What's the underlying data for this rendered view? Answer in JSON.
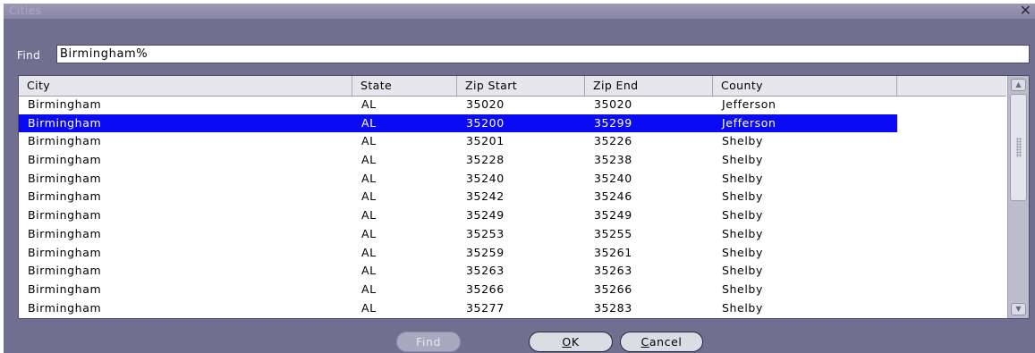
{
  "window": {
    "title": "Cities",
    "close_glyph": "✕"
  },
  "find": {
    "label": "Find",
    "value": "Birmingham%"
  },
  "table": {
    "columns": [
      "City",
      "State",
      "Zip Start",
      "Zip End",
      "County"
    ],
    "selected_index": 1,
    "rows": [
      [
        "Birmingham",
        "AL",
        "35020",
        "35020",
        "Jefferson"
      ],
      [
        "Birmingham",
        "AL",
        "35200",
        "35299",
        "Jefferson"
      ],
      [
        "Birmingham",
        "AL",
        "35201",
        "35226",
        "Shelby"
      ],
      [
        "Birmingham",
        "AL",
        "35228",
        "35238",
        "Shelby"
      ],
      [
        "Birmingham",
        "AL",
        "35240",
        "35240",
        "Shelby"
      ],
      [
        "Birmingham",
        "AL",
        "35242",
        "35246",
        "Shelby"
      ],
      [
        "Birmingham",
        "AL",
        "35249",
        "35249",
        "Shelby"
      ],
      [
        "Birmingham",
        "AL",
        "35253",
        "35255",
        "Shelby"
      ],
      [
        "Birmingham",
        "AL",
        "35259",
        "35261",
        "Shelby"
      ],
      [
        "Birmingham",
        "AL",
        "35263",
        "35263",
        "Shelby"
      ],
      [
        "Birmingham",
        "AL",
        "35266",
        "35266",
        "Shelby"
      ],
      [
        "Birmingham",
        "AL",
        "35277",
        "35283",
        "Shelby"
      ]
    ]
  },
  "buttons": {
    "find": {
      "label": "Find",
      "enabled": false
    },
    "ok": {
      "mnemonic": "O",
      "rest": "K"
    },
    "cancel": {
      "mnemonic": "C",
      "rest": "ancel"
    }
  },
  "colors": {
    "dialog_bg": "#716f90",
    "selection": "#0a0af5",
    "grid_bg": "#ffffff"
  }
}
